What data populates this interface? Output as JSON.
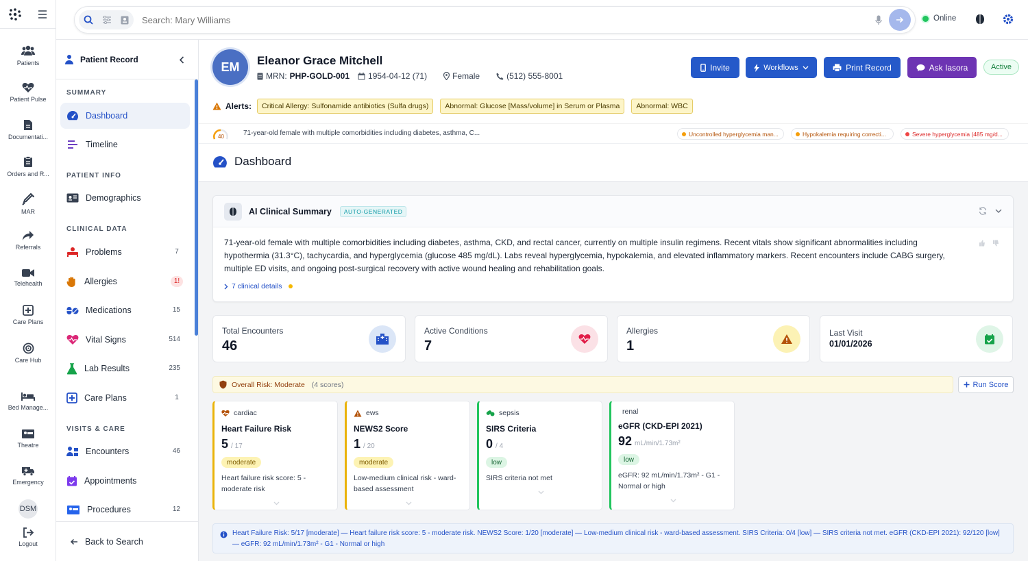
{
  "nav": {
    "items": [
      {
        "label": "Patients"
      },
      {
        "label": "Patient Pulse"
      },
      {
        "label": "Documentati..."
      },
      {
        "label": "Orders and R..."
      },
      {
        "label": "MAR"
      },
      {
        "label": "Referrals"
      },
      {
        "label": "Telehealth"
      },
      {
        "label": "Care Plans"
      },
      {
        "label": "Care Hub"
      },
      {
        "label": "Bed Manage..."
      },
      {
        "label": "Theatre"
      },
      {
        "label": "Emergency"
      }
    ],
    "user_initials": "DSM",
    "logout": "Logout"
  },
  "search": {
    "placeholder": "Search: Mary Williams"
  },
  "status": {
    "label": "Online",
    "color": "#22c55e"
  },
  "sidebar": {
    "title": "Patient Record",
    "sections": {
      "summary": "SUMMARY",
      "patient_info": "PATIENT INFO",
      "clinical": "CLINICAL DATA",
      "visits": "VISITS & CARE"
    },
    "items": {
      "dashboard": {
        "label": "Dashboard"
      },
      "timeline": {
        "label": "Timeline"
      },
      "demographics": {
        "label": "Demographics"
      },
      "problems": {
        "label": "Problems",
        "count": "7"
      },
      "allergies": {
        "label": "Allergies",
        "count": "1!"
      },
      "medications": {
        "label": "Medications",
        "count": "15"
      },
      "vitals": {
        "label": "Vital Signs",
        "count": "514"
      },
      "labs": {
        "label": "Lab Results",
        "count": "235"
      },
      "careplans": {
        "label": "Care Plans",
        "count": "1"
      },
      "encounters": {
        "label": "Encounters",
        "count": "46"
      },
      "appointments": {
        "label": "Appointments"
      },
      "procedures": {
        "label": "Procedures",
        "count": "12"
      }
    },
    "back": "Back to Search"
  },
  "patient": {
    "initials": "EM",
    "name": "Eleanor Grace Mitchell",
    "mrn_label": "MRN:",
    "mrn": "PHP-GOLD-001",
    "dob": "1954-04-12 (71)",
    "sex": "Female",
    "phone": "(512) 555-8001",
    "status": "Active"
  },
  "actions": {
    "invite": "Invite",
    "workflows": "Workflows",
    "print": "Print Record",
    "ask": "Ask Iasora"
  },
  "alerts": {
    "label": "Alerts:",
    "items": [
      "Critical Allergy: Sulfonamide antibiotics (Sulfa drugs)",
      "Abnormal: Glucose [Mass/volume] in Serum or Plasma",
      "Abnormal: WBC"
    ]
  },
  "summary_line": {
    "score": "40",
    "text": "71-year-old female with multiple comorbidities including diabetes, asthma, C...",
    "tags": [
      {
        "text": "Uncontrolled hyperglycemia man...",
        "color": "#f59e0b"
      },
      {
        "text": "Hypokalemia requiring correcti...",
        "color": "#f59e0b"
      },
      {
        "text": "Severe hyperglycemia (485 mg/d...",
        "color": "#ef4444"
      }
    ]
  },
  "page_title": "Dashboard",
  "ai_summary": {
    "title": "AI Clinical Summary",
    "badge": "AUTO-GENERATED",
    "body": "71-year-old female with multiple comorbidities including diabetes, asthma, CKD, and rectal cancer, currently on multiple insulin regimens. Recent vitals show significant abnormalities including hypothermia (31.3°C), tachycardia, and hyperglycemia (glucose 485 mg/dL). Labs reveal hyperglycemia, hypokalemia, and elevated inflammatory markers. Recent encounters include CABG surgery, multiple ED visits, and ongoing post-surgical recovery with active wound healing and rehabilitation goals.",
    "details_link": "7 clinical details"
  },
  "stats": [
    {
      "label": "Total Encounters",
      "value": "46"
    },
    {
      "label": "Active Conditions",
      "value": "7"
    },
    {
      "label": "Allergies",
      "value": "1"
    },
    {
      "label": "Last Visit",
      "value": "01/01/2026"
    }
  ],
  "risk": {
    "overall": "Overall Risk: Moderate",
    "count": "(4 scores)",
    "run_button": "Run Score",
    "cards": [
      {
        "category": "cardiac",
        "title": "Heart Failure Risk",
        "score": "5",
        "max": "/ 17",
        "level": "moderate",
        "desc": "Heart failure risk score: 5 - moderate risk"
      },
      {
        "category": "ews",
        "title": "NEWS2 Score",
        "score": "1",
        "max": "/ 20",
        "level": "moderate",
        "desc": "Low-medium clinical risk - ward-based assessment"
      },
      {
        "category": "sepsis",
        "title": "SIRS Criteria",
        "score": "0",
        "max": "/ 4",
        "level": "low",
        "desc": "SIRS criteria not met"
      },
      {
        "category": "renal",
        "title": "eGFR (CKD-EPI 2021)",
        "score": "92",
        "max": "mL/min/1.73m²",
        "level": "low",
        "desc": "eGFR: 92 mL/min/1.73m² - G1 - Normal or high"
      }
    ],
    "info": "Heart Failure Risk: 5/17 [moderate] — Heart failure risk score: 5 - moderate risk. NEWS2 Score: 1/20 [moderate] — Low-medium clinical risk - ward-based assessment. SIRS Criteria: 0/4 [low] — SIRS criteria not met. eGFR (CKD-EPI 2021): 92/120 [low] — eGFR: 92 mL/min/1.73m² - G1 - Normal or high"
  }
}
